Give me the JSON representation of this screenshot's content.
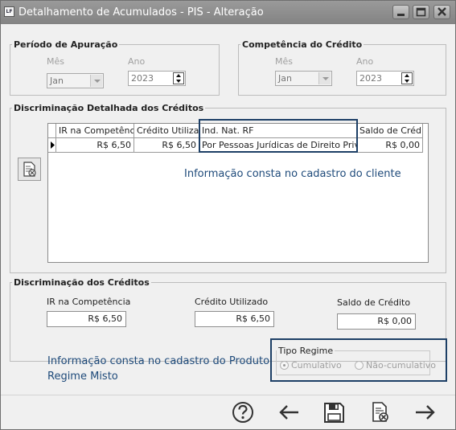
{
  "window": {
    "title": "Detalhamento de Acumulados - PIS - Alteração",
    "app_icon_text": "LF"
  },
  "periodo": {
    "legend": "Período de Apuração",
    "mes_label": "Mês",
    "mes_value": "Jan",
    "ano_label": "Ano",
    "ano_value": "2023"
  },
  "competencia": {
    "legend": "Competência do Crédito",
    "mes_label": "Mês",
    "mes_value": "Jan",
    "ano_label": "Ano",
    "ano_value": "2023"
  },
  "detalhada": {
    "legend": "Discriminação Detalhada dos Créditos",
    "columns": [
      "IR na Competência",
      "Crédito Utilizado",
      "Ind. Nat. RF",
      "Saldo de Crédito"
    ],
    "rows": [
      [
        "R$ 6,50",
        "R$ 6,50",
        "Por Pessoas Jurídicas de Direito Privado",
        "R$ 0,00"
      ]
    ],
    "note": "Informação consta no cadastro do cliente"
  },
  "creditos": {
    "legend": "Discriminação dos Créditos",
    "ir_label": "IR na Competência",
    "ir_value": "R$ 6,50",
    "utilizado_label": "Crédito Utilizado",
    "utilizado_value": "R$ 6,50",
    "saldo_label": "Saldo de Crédito",
    "saldo_value": "R$ 0,00"
  },
  "produto_note": {
    "line1": "Informação consta no cadastro do Produto",
    "line2": "Regime Misto"
  },
  "tipo_regime": {
    "legend": "Tipo Regime",
    "options": [
      "Cumulativo",
      "Não-cumulativo"
    ],
    "selected": "Cumulativo"
  },
  "footer_icons": [
    "help-icon",
    "back-arrow-icon",
    "save-icon",
    "delete-document-icon",
    "forward-arrow-icon"
  ],
  "colors": {
    "titlebar": "#8f8f8f",
    "highlight_border": "#1d3f66",
    "note_text": "#1e4a7a"
  }
}
